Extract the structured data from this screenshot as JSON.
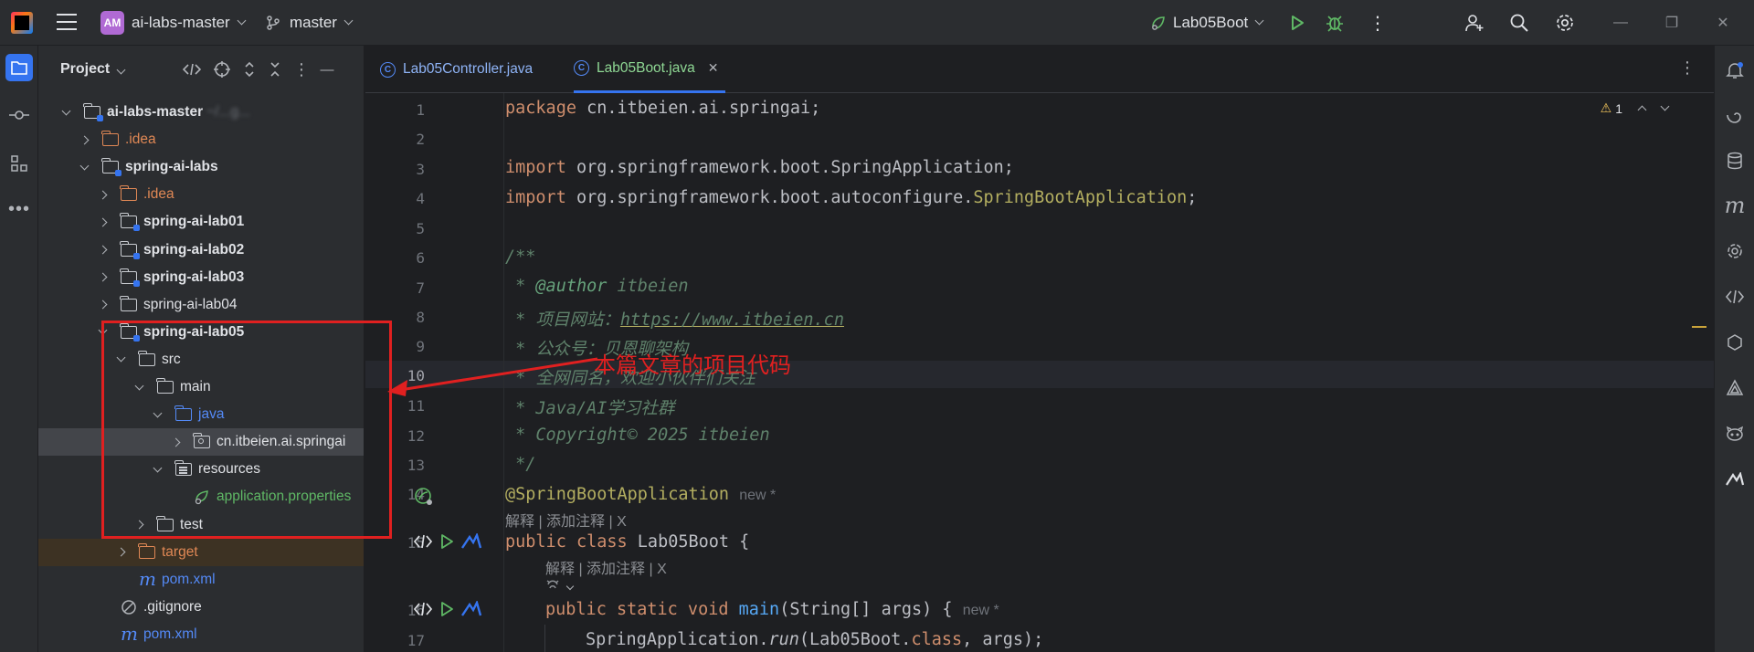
{
  "titlebar": {
    "project_badge": "AM",
    "project_name": "ai-labs-master",
    "branch": "master",
    "run_config": "Lab05Boot"
  },
  "project_panel": {
    "title": "Project",
    "tree": [
      {
        "label": "ai-labs-master",
        "suffix": "  ~/...g...",
        "depth": 0,
        "expanded": true,
        "type": "module",
        "bold": true
      },
      {
        "label": ".idea",
        "depth": 1,
        "expanded": false,
        "type": "folder",
        "color": "orange"
      },
      {
        "label": "spring-ai-labs",
        "depth": 1,
        "expanded": true,
        "type": "module",
        "bold": true
      },
      {
        "label": ".idea",
        "depth": 2,
        "expanded": false,
        "type": "folder",
        "color": "orange"
      },
      {
        "label": "spring-ai-lab01",
        "depth": 2,
        "expanded": false,
        "type": "module",
        "bold": true
      },
      {
        "label": "spring-ai-lab02",
        "depth": 2,
        "expanded": false,
        "type": "module",
        "bold": true
      },
      {
        "label": "spring-ai-lab03",
        "depth": 2,
        "expanded": false,
        "type": "module",
        "bold": true
      },
      {
        "label": "spring-ai-lab04",
        "depth": 2,
        "expanded": false,
        "type": "folder"
      },
      {
        "label": "spring-ai-lab05",
        "depth": 2,
        "expanded": true,
        "type": "module",
        "bold": true
      },
      {
        "label": "src",
        "depth": 3,
        "expanded": true,
        "type": "folder"
      },
      {
        "label": "main",
        "depth": 4,
        "expanded": true,
        "type": "folder"
      },
      {
        "label": "java",
        "depth": 5,
        "expanded": true,
        "type": "folder",
        "color": "blue"
      },
      {
        "label": "cn.itbeien.ai.springai",
        "depth": 6,
        "expanded": false,
        "type": "package",
        "selected": true
      },
      {
        "label": "resources",
        "depth": 5,
        "expanded": true,
        "type": "resources"
      },
      {
        "label": "application.properties",
        "depth": 6,
        "leaf": true,
        "type": "spring",
        "color": "green"
      },
      {
        "label": "test",
        "depth": 4,
        "expanded": false,
        "type": "folder"
      },
      {
        "label": "target",
        "depth": 3,
        "expanded": false,
        "type": "folder",
        "color": "orange",
        "target": true
      },
      {
        "label": "pom.xml",
        "depth": 3,
        "leaf": true,
        "type": "maven",
        "color": "blue"
      },
      {
        "label": ".gitignore",
        "depth": 2,
        "leaf": true,
        "type": "ignore"
      },
      {
        "label": "pom.xml",
        "depth": 2,
        "leaf": true,
        "type": "maven",
        "color": "blue"
      }
    ]
  },
  "tabs": [
    {
      "label": "Lab05Controller.java",
      "active": false
    },
    {
      "label": "Lab05Boot.java",
      "active": true
    }
  ],
  "editor": {
    "warning_count": "1",
    "hint_new": "new *",
    "codevision_a": "解释 | 添加注释 | X",
    "codevision_b": "解释 | 添加注释 | X",
    "lines": {
      "l1": [
        "package",
        " cn.itbeien.ai.springai;"
      ],
      "l3": [
        "import",
        " org.springframework.boot.SpringApplication;"
      ],
      "l4": [
        "import",
        " org.springframework.boot.autoconfigure.",
        "SpringBootApplication",
        ";"
      ],
      "l6": "/**",
      "l7": [
        " * ",
        "@author",
        " itbeien"
      ],
      "l8": [
        " * 项目网站：",
        "https://www.itbeien.cn"
      ],
      "l9": " * 公众号：贝恩聊架构",
      "l10": " * 全网同名，欢迎小伙伴们关注",
      "l11": " * Java/AI学习社群",
      "l12": " * Copyright© 2025 itbeien",
      "l13": " */",
      "l14": "@SpringBootApplication",
      "l15": [
        "public class",
        " Lab05Boot {"
      ],
      "l16": [
        "public static void",
        " ",
        "main",
        "(String[] args) {"
      ],
      "l17": [
        "SpringApplication.",
        "run",
        "(Lab05Boot.",
        "class",
        ", args);"
      ]
    },
    "line_numbers": [
      "1",
      "2",
      "3",
      "4",
      "5",
      "6",
      "7",
      "8",
      "9",
      "10",
      "11",
      "12",
      "13",
      "14",
      "15",
      "16",
      "17"
    ]
  },
  "annotation": {
    "callout": "本篇文章的项目代码",
    "color": "#e02020"
  }
}
